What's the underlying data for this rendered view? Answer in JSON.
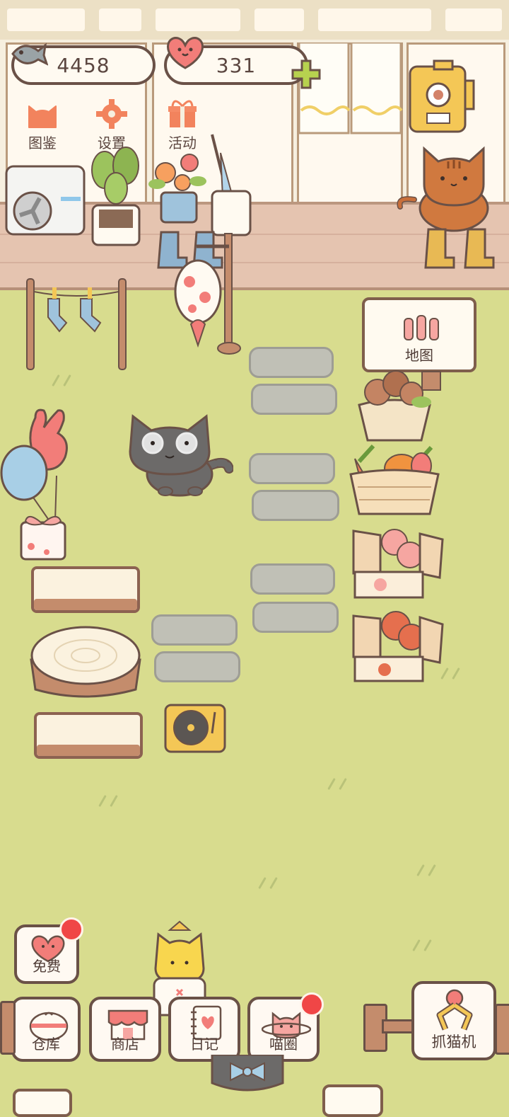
{
  "resources": {
    "fish": {
      "icon": "fish-icon",
      "value": "4458"
    },
    "hearts": {
      "icon": "heart-icon",
      "value": "331",
      "add_icon": "plus-icon"
    }
  },
  "top_menu": [
    {
      "id": "encyclopedia",
      "label": "图鉴",
      "icon": "cat-head-icon"
    },
    {
      "id": "settings",
      "label": "设置",
      "icon": "gear-icon"
    },
    {
      "id": "events",
      "label": "活动",
      "icon": "gift-icon"
    }
  ],
  "map_sign": {
    "label": "地图",
    "icon": "fence-icon"
  },
  "free_button": {
    "label": "免费",
    "icon": "heart-face-icon",
    "has_badge": true
  },
  "bottom_bar": [
    {
      "id": "warehouse",
      "label": "仓库",
      "icon": "pot-icon"
    },
    {
      "id": "shop",
      "label": "商店",
      "icon": "shop-icon"
    },
    {
      "id": "diary",
      "label": "日记",
      "icon": "notebook-icon"
    },
    {
      "id": "cat-circle",
      "label": "喵圈",
      "icon": "cat-planet-icon",
      "has_badge": true
    }
  ],
  "claw_machine": {
    "label": "抓猫机",
    "icon": "claw-icon"
  },
  "colors": {
    "grass": "#d8dc8e",
    "badge": "#f04646",
    "outline": "#6a5147"
  }
}
